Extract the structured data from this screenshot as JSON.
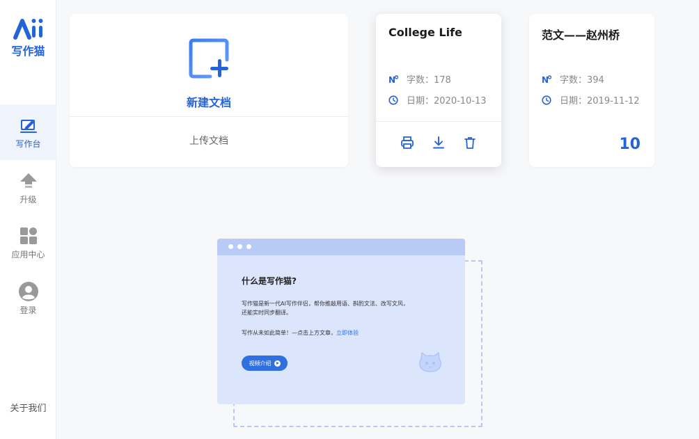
{
  "app": {
    "logo_text": "写作猫"
  },
  "sidebar": {
    "items": [
      {
        "label": "写作台",
        "icon": "pen-square-icon",
        "active": true
      },
      {
        "label": "升级",
        "icon": "arrow-up-icon",
        "active": false
      },
      {
        "label": "应用中心",
        "icon": "apps-grid-icon",
        "active": false
      },
      {
        "label": "登录",
        "icon": "user-avatar-icon",
        "active": false
      }
    ],
    "about": "关于我们"
  },
  "new_doc": {
    "label": "新建文档",
    "upload_label": "上传文档"
  },
  "documents": [
    {
      "title": "College Life",
      "word_count_label": "字数：178",
      "date_label": "日期：2020-10-13",
      "actions": [
        "print-icon",
        "download-icon",
        "delete-icon"
      ]
    },
    {
      "title": "范文——赵州桥",
      "word_count_label": "字数：394",
      "date_label": "日期：2019-11-12",
      "count": "10"
    }
  ],
  "promo": {
    "title": "什么是写作猫?",
    "desc_line1": "写作猫是新一代AI写作伴侣，帮你推敲用语、斟酌文法、改写文风，",
    "desc_line2": "还能实时同步翻译。",
    "cta_text": "写作从未如此简单！—点击上方文章，",
    "cta_link": "立即体验",
    "button_label": "视频介绍"
  },
  "colors": {
    "accent": "#2563d9",
    "promo_bg": "#dbe6fd",
    "promo_bar": "#b8cbf7"
  }
}
